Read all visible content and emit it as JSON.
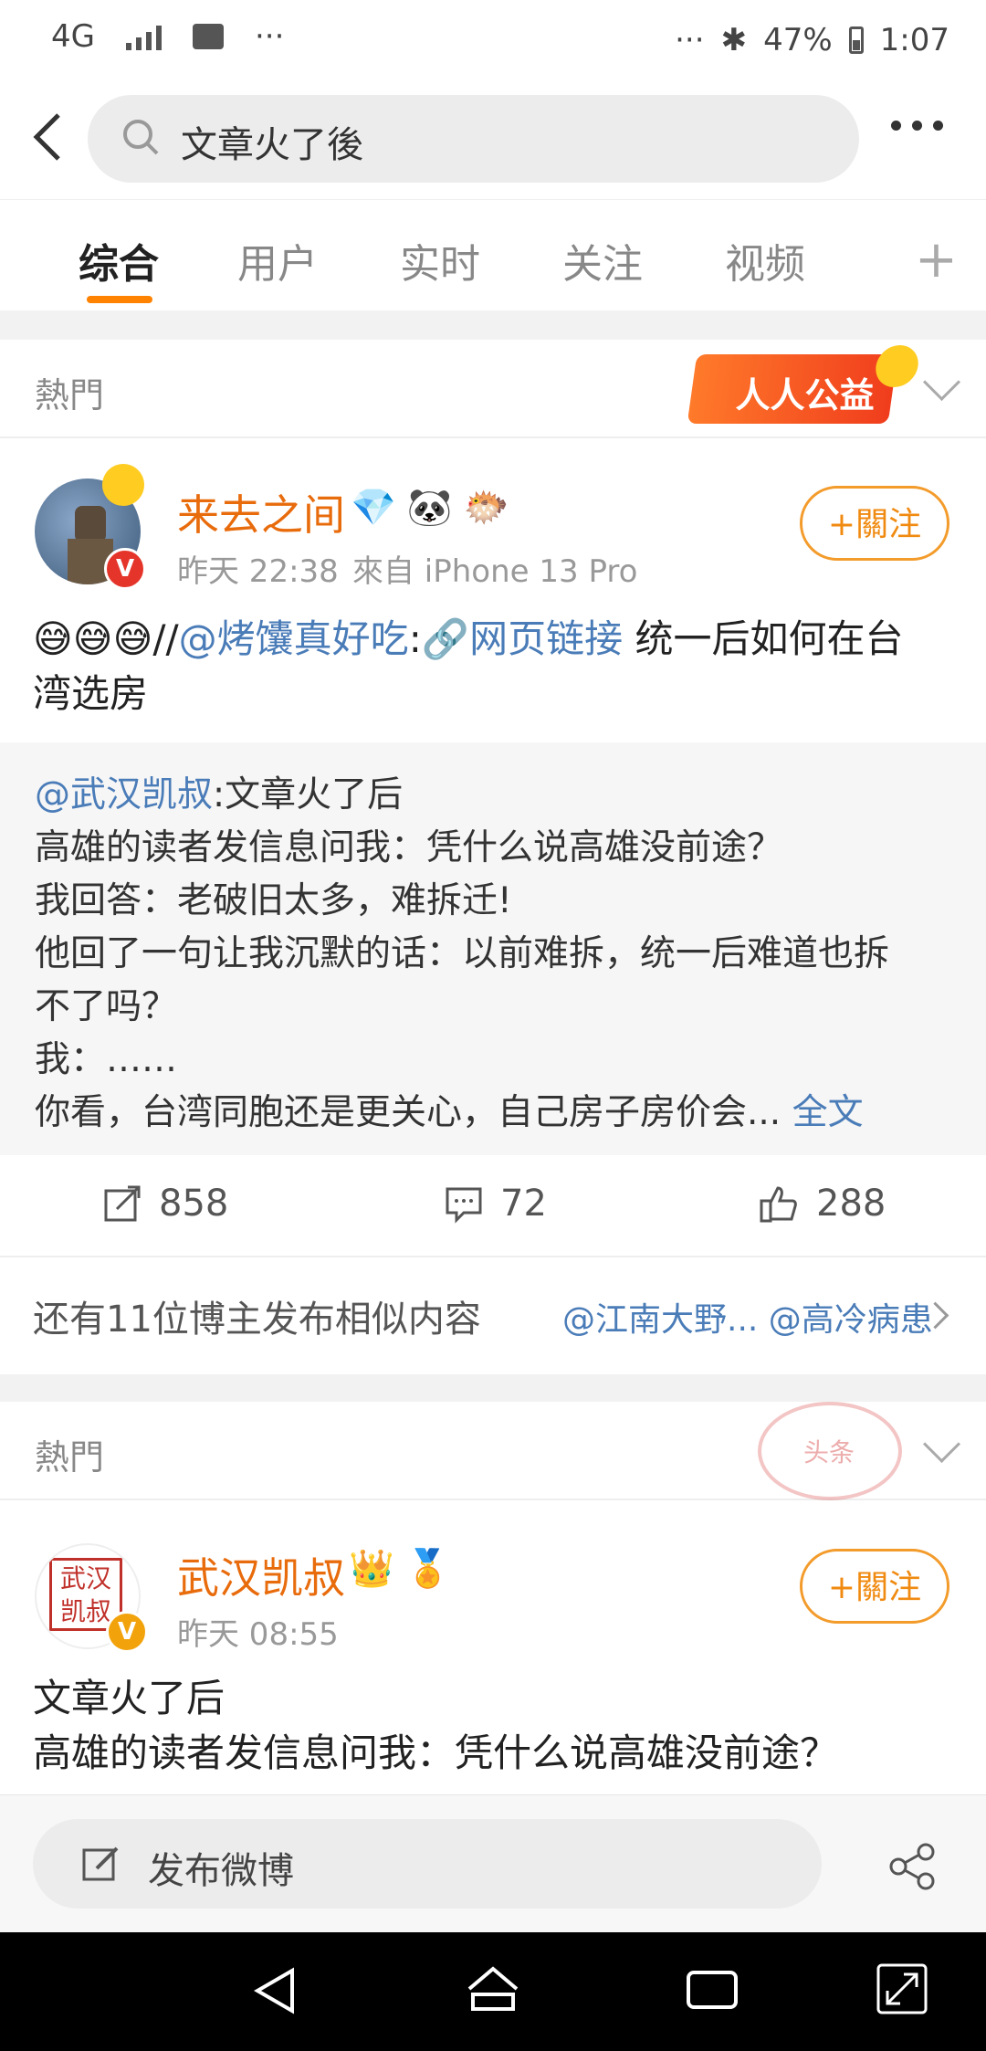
{
  "status": {
    "network": "4G",
    "time": "1:07",
    "battery": "47%"
  },
  "search": {
    "query": "文章火了後"
  },
  "tabs": [
    {
      "label": "综合"
    },
    {
      "label": "用户"
    },
    {
      "label": "实时"
    },
    {
      "label": "关注"
    },
    {
      "label": "视频"
    }
  ],
  "hot_label": "熱門",
  "gongyi_badge": "人人公益",
  "stamp_text": "头条",
  "post1": {
    "username": "来去之间",
    "time": "昨天 22:38",
    "source": "來自 iPhone 13 Pro",
    "follow": "+關注",
    "emoji": "😅😅😅",
    "slashes": "//",
    "mention": "@烤馕真好吃",
    "colon": ":",
    "link_text": "🔗网页链接",
    "text1": " 统一后如何在台",
    "text2": "湾选房",
    "retweet": {
      "mention": "@武汉凯叔",
      "line1": ":文章火了后",
      "line2": "高雄的读者发信息问我：凭什么说高雄没前途？",
      "line3": "我回答：老破旧太多，难拆迁!",
      "line4": "他回了一句让我沉默的话：以前难拆，统一后难道也拆",
      "line5": "不了吗？",
      "line6": "我：……",
      "line7": "你看，台湾同胞还是更关心，自己房子房价会...",
      "full": "全文"
    },
    "reposts": "858",
    "comments": "72",
    "likes": "288",
    "similar_text": "还有11位博主发布相似内容",
    "similar_authors": "@江南大野... @高冷病患"
  },
  "post2": {
    "username": "武汉凯叔",
    "avatar_text": "武汉凯叔",
    "time": "昨天 08:55",
    "follow": "+關注",
    "line1": "文章火了后",
    "line2": "高雄的读者发信息问我：凭什么说高雄没前途？"
  },
  "compose": {
    "label": "发布微博"
  },
  "colors": {
    "accent": "#ff8200",
    "link": "#4a7cb8",
    "username": "#e86b0c"
  }
}
